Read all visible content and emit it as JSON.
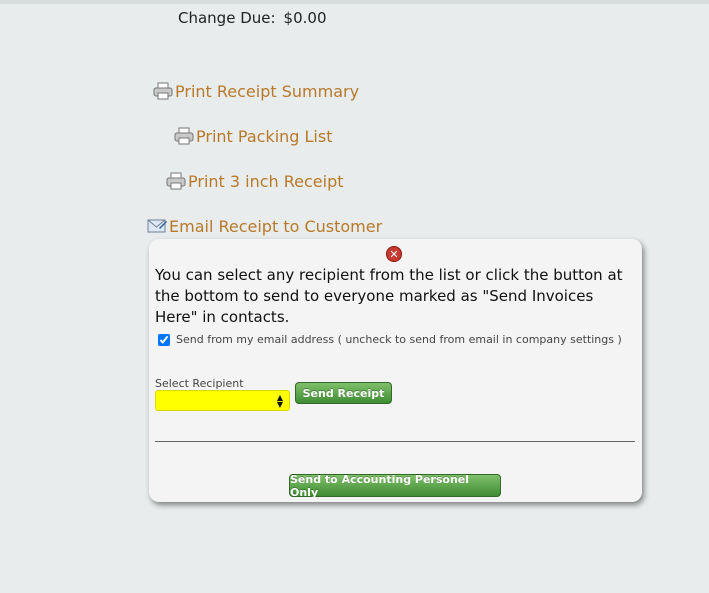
{
  "change_due": {
    "label": "Change Due:",
    "value": "$0.00"
  },
  "links": {
    "print_receipt_summary": "Print Receipt Summary",
    "print_packing_list": "Print Packing List",
    "print_3_inch_receipt": "Print 3 inch Receipt",
    "email_receipt": "Email Receipt to Customer"
  },
  "icons": {
    "printer": "printer-icon",
    "email": "email-icon",
    "close": "close-icon"
  },
  "panel": {
    "message": "You can select any recipient from the list or click the button at the bottom to send to everyone marked as \"Send Invoices Here\" in contacts.",
    "checkbox_label": "Send from my email address ( uncheck to send from email in company settings )",
    "checkbox_checked": true,
    "select_label": "Select Recipient",
    "select_value": "",
    "send_receipt_label": "Send Receipt",
    "send_accounting_label": "Send to Accounting Personel Only"
  },
  "colors": {
    "link": "#b8792a",
    "button_green": "#4f9a40",
    "select_bg": "#ffff00",
    "close_red": "#c63a2f"
  }
}
